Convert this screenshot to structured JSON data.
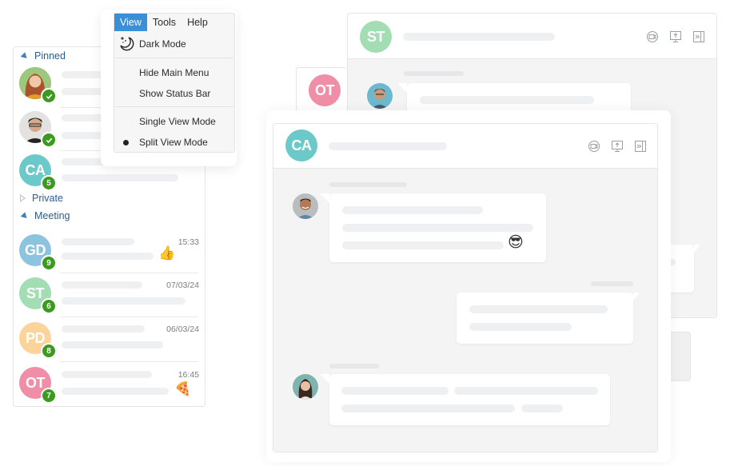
{
  "menu": {
    "bar": [
      "View",
      "Tools",
      "Help"
    ],
    "active": "View",
    "items": {
      "dark_mode": "Dark Mode",
      "hide_main_menu": "Hide Main Menu",
      "show_status_bar": "Show Status Bar",
      "single_view_mode": "Single View Mode",
      "split_view_mode": "Split View Mode"
    },
    "selected_mode": "Split View Mode"
  },
  "sidebar": {
    "groups": {
      "pinned": "Pinned",
      "private": "Private",
      "meeting": "Meeting"
    },
    "pinned": [
      {
        "type": "photo",
        "status": "online-check"
      },
      {
        "type": "photo",
        "status": "online-check"
      },
      {
        "initials": "CA",
        "color": "#6cc9c9",
        "unread": "5"
      }
    ],
    "meeting": [
      {
        "initials": "GD",
        "color": "#8cc4e0",
        "unread": "9",
        "time": "15:33",
        "emoji": "👍"
      },
      {
        "initials": "ST",
        "color": "#a3ddb4",
        "unread": "6",
        "time": "07/03/24",
        "emoji": ""
      },
      {
        "initials": "PD",
        "color": "#fcd39b",
        "unread": "8",
        "time": "06/03/24",
        "emoji": ""
      },
      {
        "initials": "OT",
        "color": "#ef8ea6",
        "unread": "7",
        "time": "16:45",
        "emoji": "🍕"
      }
    ]
  },
  "windows": {
    "back": {
      "initials": "ST",
      "color": "#a3ddb4"
    },
    "peek": {
      "initials": "OT",
      "color": "#ef8ea6"
    },
    "front": {
      "initials": "CA",
      "color": "#6cc9c9",
      "message_emoji": "😎"
    }
  },
  "header_icons": [
    "video-call-icon",
    "screen-share-icon",
    "collapse-panel-icon"
  ],
  "colors": {
    "accent": "#3b8fd6",
    "badge": "#3c9a1f",
    "group_label": "#2a5d8f"
  }
}
